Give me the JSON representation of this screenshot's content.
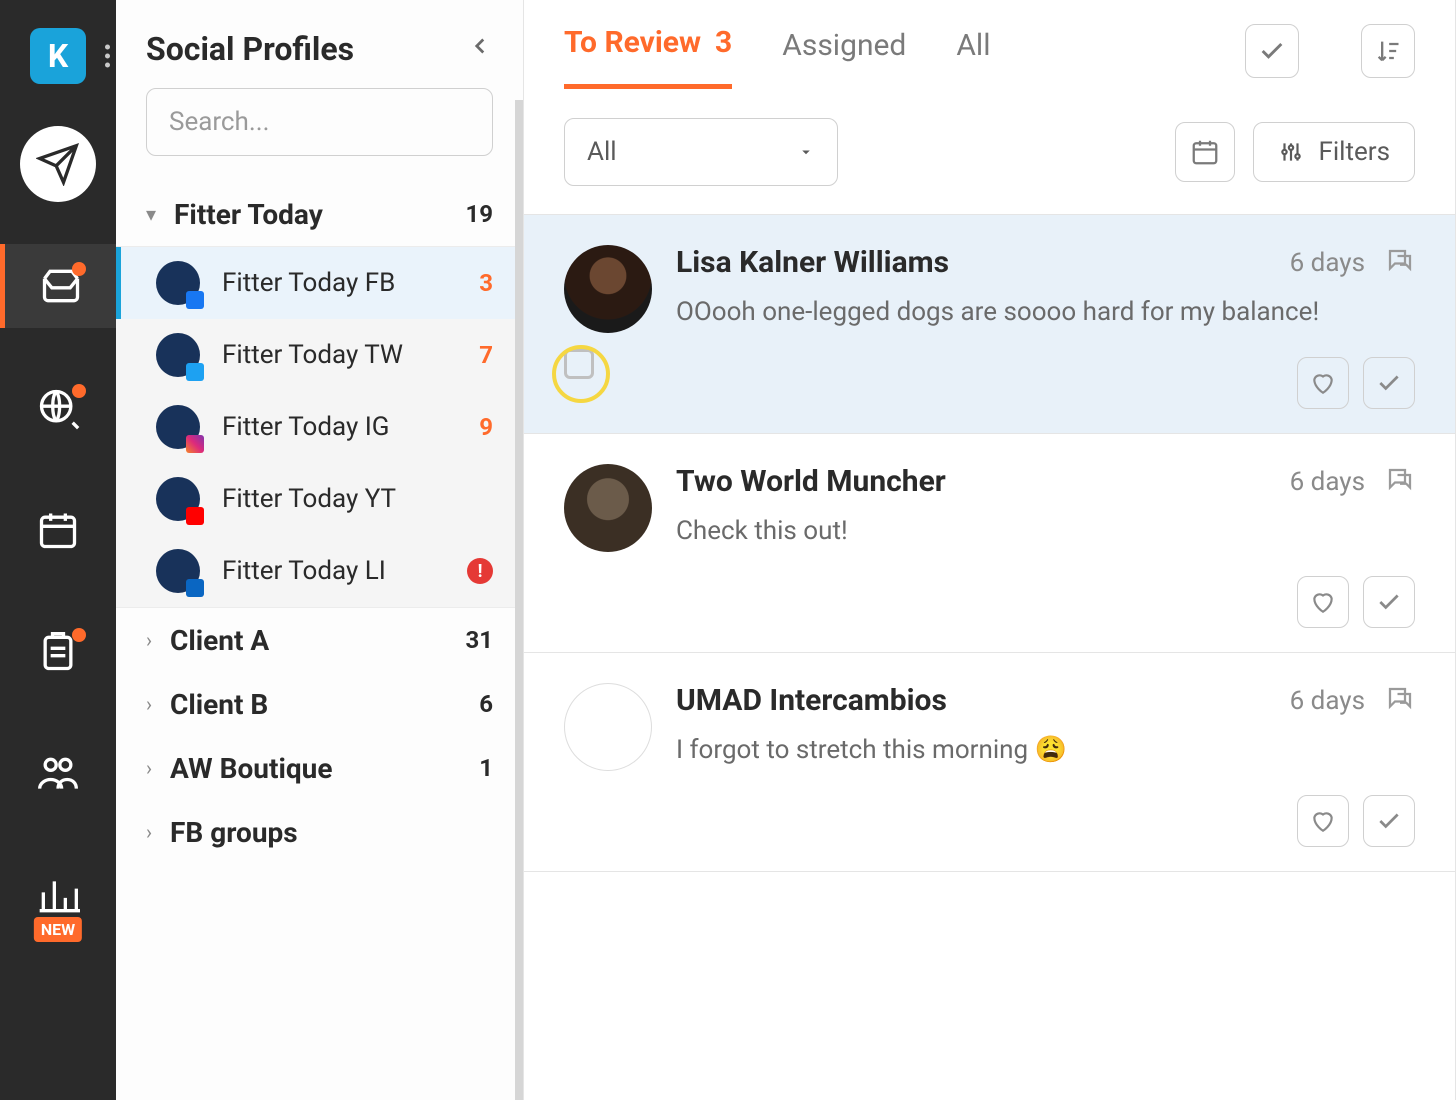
{
  "brand_letter": "K",
  "rail_new_badge": "NEW",
  "profiles": {
    "title": "Social Profiles",
    "search_placeholder": "Search...",
    "groups": [
      {
        "name": "Fitter Today",
        "count": "19",
        "expanded": true,
        "items": [
          {
            "name": "Fitter Today FB",
            "count": "3",
            "net": "fb",
            "active": true
          },
          {
            "name": "Fitter Today TW",
            "count": "7",
            "net": "tw",
            "active": false
          },
          {
            "name": "Fitter Today IG",
            "count": "9",
            "net": "ig",
            "active": false
          },
          {
            "name": "Fitter Today YT",
            "count": "",
            "net": "yt",
            "active": false
          },
          {
            "name": "Fitter Today LI",
            "count": "",
            "net": "li",
            "active": false,
            "alert": true
          }
        ]
      },
      {
        "name": "Client A",
        "count": "31",
        "expanded": false
      },
      {
        "name": "Client B",
        "count": "6",
        "expanded": false
      },
      {
        "name": "AW Boutique",
        "count": "1",
        "expanded": false
      },
      {
        "name": "FB groups",
        "count": "",
        "expanded": false
      }
    ]
  },
  "tabs": {
    "to_review": {
      "label": "To Review",
      "count": "3"
    },
    "assigned": {
      "label": "Assigned"
    },
    "all": {
      "label": "All"
    }
  },
  "filter_dropdown": {
    "selected": "All"
  },
  "filters_button": "Filters",
  "messages": [
    {
      "author": "Lisa Kalner Williams",
      "time": "6 days",
      "text": "OOooh one-legged dogs are soooo hard for my balance!",
      "highlight": true,
      "show_checkbox": true,
      "avatar_class": "av1"
    },
    {
      "author": "Two World Muncher",
      "time": "6 days",
      "text": "Check this out!",
      "highlight": false,
      "show_checkbox": false,
      "avatar_class": "av2"
    },
    {
      "author": "UMAD Intercambios",
      "time": "6 days",
      "text": "I forgot to stretch this morning 😩",
      "highlight": false,
      "show_checkbox": false,
      "avatar_class": "av3"
    }
  ]
}
